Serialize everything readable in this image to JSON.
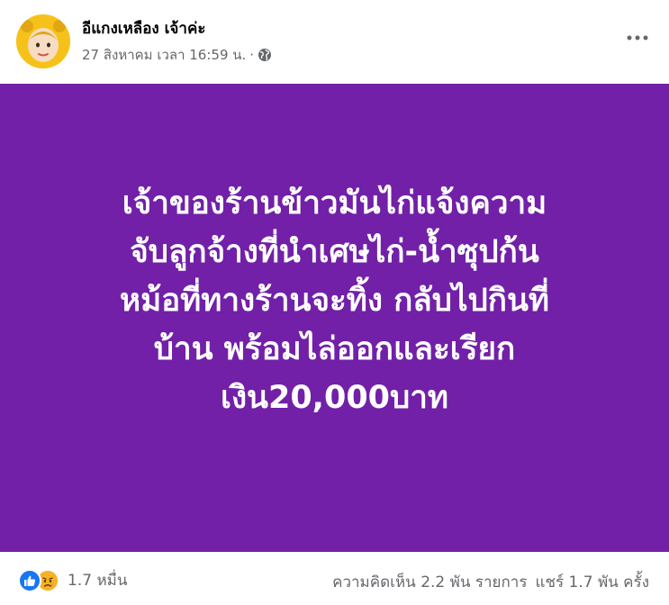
{
  "post": {
    "author_name": "อีแกงเหลือง เจ้าค่ะ",
    "timestamp": "27 สิงหาคม เวลา 16:59 น.",
    "separator": "·",
    "privacy_icon": "globe-icon",
    "more_icon": "more-options-icon",
    "background_color": "#7220a8",
    "headline_lines": [
      "เจ้าของร้านข้าวมันไก่แจ้งความ",
      "จับลูกจ้างที่นำเศษไก่-น้ำซุปก้น",
      "หม้อที่ทางร้านจะทิ้ง กลับไปกินที่",
      "บ้าน พร้อมไล่ออกและเรียก",
      "เงิน20,000บาท"
    ]
  },
  "footer": {
    "reaction_icons": [
      "like-icon",
      "sad-icon"
    ],
    "reaction_count": "1.7 หมื่น",
    "comments": "ความคิดเห็น 2.2 พัน รายการ",
    "shares": "แชร์ 1.7 พัน ครั้ง"
  },
  "colors": {
    "accent_blue": "#1877f2",
    "secondary_text": "#65676b",
    "sad_yellow": "#f7b125",
    "avatar_yellow": "#f6c21a"
  }
}
